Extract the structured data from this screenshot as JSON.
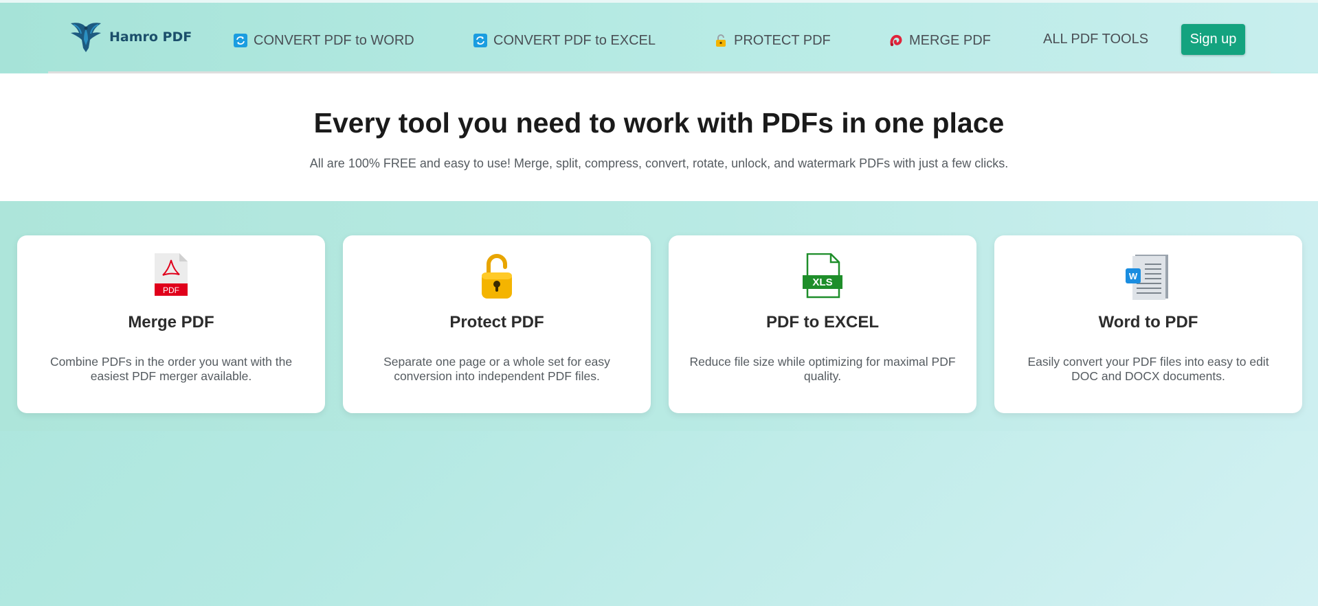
{
  "header": {
    "logo_text": "Hamro PDF",
    "nav": [
      {
        "label": "CONVERT PDF to WORD",
        "icon": "convert-icon"
      },
      {
        "label": "CONVERT PDF to EXCEL",
        "icon": "convert-icon"
      },
      {
        "label": "PROTECT PDF",
        "icon": "lock-icon"
      },
      {
        "label": "MERGE PDF",
        "icon": "merge-icon"
      },
      {
        "label": "ALL PDF TOOLS"
      }
    ],
    "signup_label": "Sign up"
  },
  "hero": {
    "title": "Every tool you need to work with PDFs in one place",
    "subtitle": "All are 100% FREE and easy to use! Merge, split, compress, convert, rotate, unlock, and watermark PDFs with just a few clicks."
  },
  "cards": [
    {
      "title": "Merge PDF",
      "description": "Combine PDFs in the order you want with the easiest PDF merger available.",
      "icon": "pdf-file-icon",
      "icon_badge": "PDF"
    },
    {
      "title": "Protect PDF",
      "description": "Separate one page or a whole set for easy conversion into independent PDF files.",
      "icon": "padlock-icon"
    },
    {
      "title": "PDF to EXCEL",
      "description": "Reduce file size while optimizing for maximal PDF quality.",
      "icon": "xls-file-icon",
      "icon_badge": "XLS"
    },
    {
      "title": "Word to PDF",
      "description": "Easily convert your PDF files into easy to edit DOC and DOCX documents.",
      "icon": "word-document-icon",
      "icon_badge": "W"
    }
  ],
  "colors": {
    "accent": "#14a37f",
    "header_bg": "#a6e3d8",
    "logo_text": "#1b4f6b",
    "pdf_red": "#e0001b",
    "xls_green": "#1e8e2a",
    "word_blue": "#1a8de0"
  }
}
